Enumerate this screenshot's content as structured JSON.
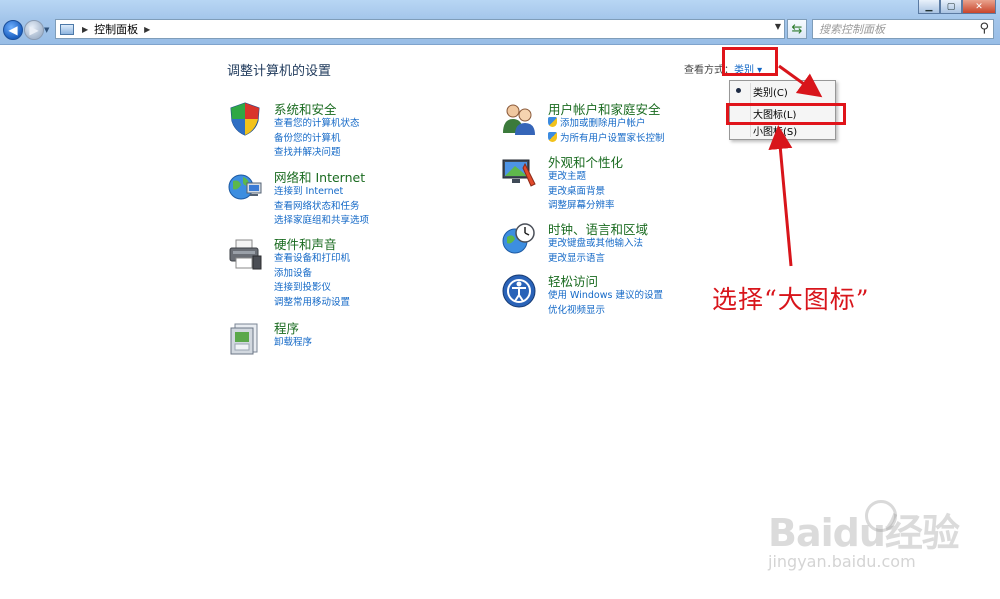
{
  "address_bar": {
    "breadcrumb": "控制面板",
    "search_placeholder": "搜索控制面板"
  },
  "page": {
    "title": "调整计算机的设置",
    "view_by_label": "查看方式：",
    "view_by_value": "类别 ▾"
  },
  "view_menu": {
    "items": [
      {
        "label": "类别(C)",
        "selected": true
      },
      {
        "label": "大图标(L)",
        "selected": false
      },
      {
        "label": "小图标(S)",
        "selected": false
      }
    ]
  },
  "categories": {
    "system": {
      "title": "系统和安全",
      "icon": "shield-icon",
      "links": [
        "查看您的计算机状态",
        "备份您的计算机",
        "查找并解决问题"
      ]
    },
    "network": {
      "title": "网络和 Internet",
      "icon": "globe-network-icon",
      "links": [
        "连接到 Internet",
        "查看网络状态和任务",
        "选择家庭组和共享选项"
      ]
    },
    "hardware": {
      "title": "硬件和声音",
      "icon": "printer-icon",
      "links": [
        "查看设备和打印机",
        "添加设备",
        "连接到投影仪",
        "调整常用移动设置"
      ]
    },
    "programs": {
      "title": "程序",
      "icon": "programs-icon",
      "links": [
        "卸载程序"
      ]
    },
    "users": {
      "title": "用户帐户和家庭安全",
      "icon": "users-icon",
      "links": [
        "添加或删除用户帐户",
        "为所有用户设置家长控制"
      ]
    },
    "appearance": {
      "title": "外观和个性化",
      "icon": "monitor-icon",
      "links": [
        "更改主题",
        "更改桌面背景",
        "调整屏幕分辨率"
      ]
    },
    "clock": {
      "title": "时钟、语言和区域",
      "icon": "clock-globe-icon",
      "links": [
        "更改键盘或其他输入法",
        "更改显示语言"
      ]
    },
    "ease": {
      "title": "轻松访问",
      "icon": "ease-of-access-icon",
      "links": [
        "使用 Windows 建议的设置",
        "优化视频显示"
      ]
    }
  },
  "annotation": {
    "text": "选择“大图标”",
    "color": "#d8151b"
  },
  "watermark": {
    "text": "Baidu经验",
    "sub": "jingyan.baidu.com"
  }
}
